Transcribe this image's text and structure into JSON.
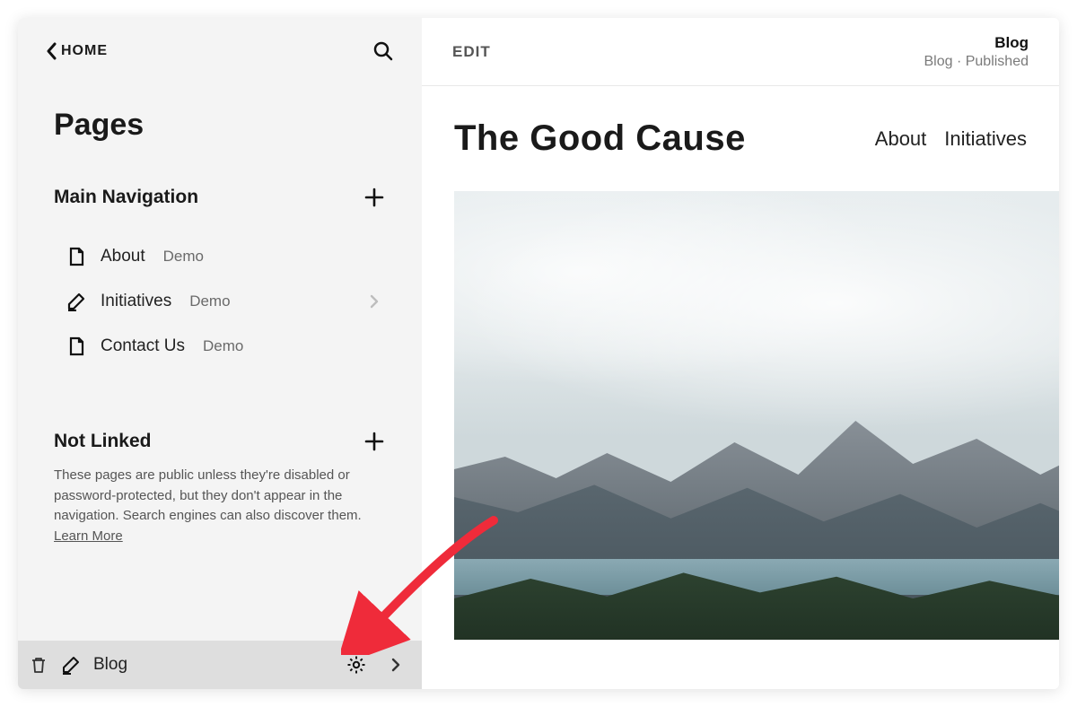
{
  "sidebar": {
    "home_label": "HOME",
    "section_title": "Pages",
    "main_nav": {
      "title": "Main Navigation",
      "items": [
        {
          "label": "About",
          "tag": "Demo",
          "has_chevron": false
        },
        {
          "label": "Initiatives",
          "tag": "Demo",
          "has_chevron": true
        },
        {
          "label": "Contact Us",
          "tag": "Demo",
          "has_chevron": false
        }
      ]
    },
    "not_linked": {
      "title": "Not Linked",
      "description": "These pages are public unless they're disabled or password-protected, but they don't appear in the navigation. Search engines can also discover them. ",
      "learn_more": "Learn More"
    },
    "selected_item": {
      "label": "Blog"
    }
  },
  "preview": {
    "edit_label": "EDIT",
    "status": {
      "title": "Blog",
      "subtitle": "Blog · Published"
    },
    "site_title": "The Good Cause",
    "site_nav": [
      "About",
      "Initiatives"
    ]
  },
  "colors": {
    "arrow": "#ef2b3a"
  }
}
